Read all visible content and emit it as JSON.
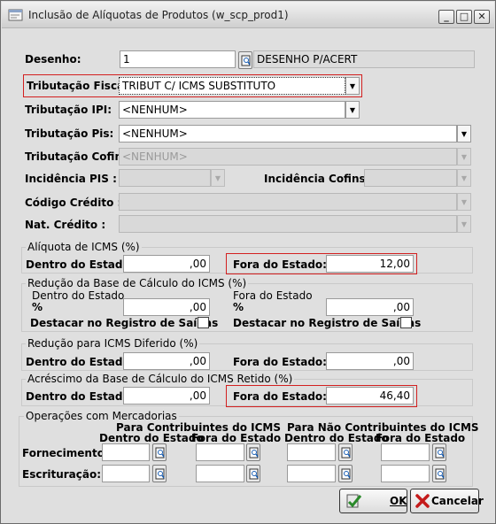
{
  "window": {
    "title": "Inclusão de Alíquotas de Produtos (w_scp_prod1)"
  },
  "desenho": {
    "label": "Desenho:",
    "code": "1",
    "description": "DESENHO P/ACERT"
  },
  "trib_fiscal": {
    "label": "Tributação Fiscal:",
    "value": "TRIBUT C/ ICMS SUBSTITUTO"
  },
  "trib_ipi": {
    "label": "Tributação IPI:",
    "value": "<NENHUM>"
  },
  "trib_pis": {
    "label": "Tributação Pis:",
    "value": "<NENHUM>"
  },
  "trib_cofins": {
    "label": "Tributação Cofins:",
    "value": "<NENHUM>"
  },
  "incid_pis": {
    "label": "Incidência PIS :",
    "value": ""
  },
  "incid_cofins": {
    "label": "Incidência Cofins :",
    "value": ""
  },
  "cod_credito": {
    "label": "Código Crédito :",
    "value": ""
  },
  "nat_credito": {
    "label": "Nat. Crédito :",
    "value": ""
  },
  "aliq_icms": {
    "title": "Alíquota de ICMS (%)",
    "dentro_label": "Dentro do Estado:",
    "dentro_value": ",00",
    "fora_label": "Fora do Estado:",
    "fora_value": "12,00"
  },
  "red_base": {
    "title": "Redução da Base de Cálculo do ICMS (%)",
    "dentro_heading": "Dentro do Estado",
    "fora_heading": "Fora do Estado",
    "pct": "%",
    "dentro_value": ",00",
    "fora_value": ",00",
    "destacar_label": "Destacar no Registro de Saídas"
  },
  "red_diferido": {
    "title": "Redução para ICMS Diferido (%)",
    "dentro_label": "Dentro do Estado:",
    "dentro_value": ",00",
    "fora_label": "Fora do Estado:",
    "fora_value": ",00"
  },
  "acrescimo": {
    "title": "Acréscimo da Base de Cálculo do ICMS Retido (%)",
    "dentro_label": "Dentro do Estado:",
    "dentro_value": ",00",
    "fora_label": "Fora do Estado:",
    "fora_value": "46,40"
  },
  "operacoes": {
    "title": "Operações com Mercadorias",
    "contrib_heading": "Para Contribuintes do ICMS",
    "nao_contrib_heading": "Para Não Contribuintes do ICMS",
    "dentro": "Dentro do Estado",
    "fora": "Fora do Estado",
    "fornecimento": "Fornecimento:",
    "escrituracao": "Escrituração:"
  },
  "buttons": {
    "ok": "OK",
    "cancel": "Cancelar"
  }
}
